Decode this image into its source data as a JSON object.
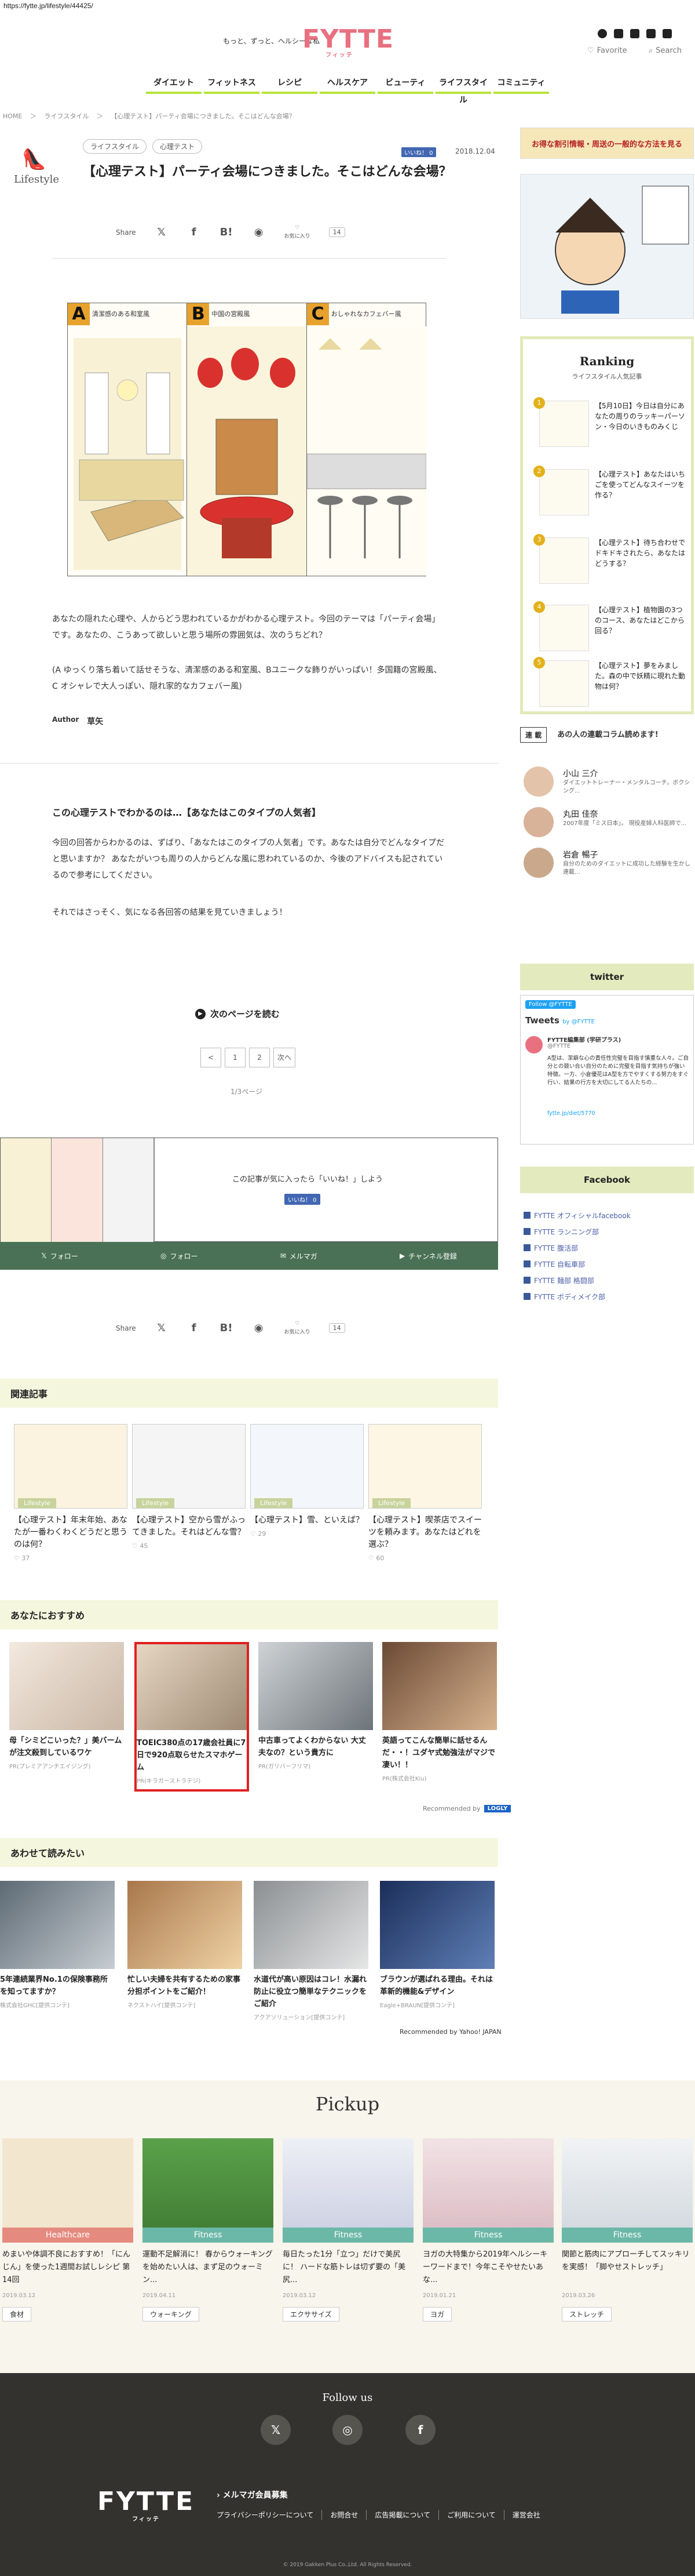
{
  "url": "https://fytte.jp/lifestyle/44425/",
  "header": {
    "tagline": "もっと、ずっと、ヘルシーな私",
    "logo": "FYTTE",
    "logo_sub": "フィッテ",
    "favorite": "Favorite",
    "search": "Search"
  },
  "nav": [
    "ダイエット",
    "フィットネス",
    "レシピ",
    "ヘルスケア",
    "ビューティ",
    "ライフスタイル",
    "コミュニティ"
  ],
  "breadcrumb": [
    "HOME",
    "＞",
    "ライフスタイル",
    "＞",
    "【心理テスト】パーティ会場につきました。そこはどんな会場？"
  ],
  "article": {
    "category": "Lifestyle",
    "tags": [
      "ライフスタイル",
      "心理テスト"
    ],
    "like_small": "いいね！ 0",
    "date": "2018.12.04",
    "title": "【心理テスト】パーティ会場につきました。そこはどんな会場？",
    "share_label": "Share",
    "fav_label": "お気に入り",
    "share_count": "14",
    "comic": {
      "a_letter": "A",
      "a_caption": "清潔感のある和室風",
      "b_letter": "B",
      "b_caption": "中国の宮殿風",
      "c_letter": "C",
      "c_caption": "おしゃれなカフェバー風"
    },
    "intro_1": "あなたの隠れた心理や、人からどう思われているかがわかる心理テスト。今回のテーマは「パーティ会場」です。あなたの、こうあって欲しいと思う場所の雰囲気は、次のうちどれ？",
    "intro_2": "(A ゆっくり落ち着いて話せそうな、清潔感のある和室風、Bユニークな飾りがいっぱい！多国籍の宮殿風、C オシャレで大人っぽい、隠れ家的なカフェバー風)",
    "author_label": "Author",
    "author_name": "草矢",
    "section_title": "この心理テストでわかるのは…【あなたはこのタイプの人気者】",
    "section_p1": "今回の回答からわかるのは、ずばり、「あなたはこのタイプの人気者」です。あなたは自分でどんなタイプだと思いますか？ あなたがいつも周りの人からどんな風に思われているのか、今後のアドバイスも記されているので参考にしてください。",
    "section_p2": "それではさっそく、気になる各回答の結果を見ていきましょう！",
    "next_page": "次のページを読む",
    "pager": [
      "<",
      "1",
      "2",
      "次へ"
    ],
    "page_indicator": "1/3ページ",
    "like_message": "この記事が気に入ったら「いいね！」しよう",
    "like_button": "いいね！ 0",
    "follow": [
      "フォロー",
      "フォロー",
      "メルマガ",
      "チャンネル登録"
    ]
  },
  "related": {
    "heading": "関連記事",
    "items": [
      {
        "label": "Lifestyle",
        "title": "【心理テスト】年末年始、あなたが一番わくわくどうだと思うのは何？",
        "count": "37"
      },
      {
        "label": "Lifestyle",
        "title": "【心理テスト】空から雪がふってきました。それはどんな雪？",
        "count": "45"
      },
      {
        "label": "Lifestyle",
        "title": "【心理テスト】雪、といえば？",
        "count": "29"
      },
      {
        "label": "Lifestyle",
        "title": "【心理テスト】喫茶店でスイーツを頼みます。あなたはどれを選ぶ？",
        "count": "60"
      }
    ]
  },
  "recommend": {
    "heading": "あなたにおすすめ",
    "items": [
      {
        "title": "母「シミどこいった？」美バームが注文殺到しているワケ",
        "source": "PR(プレミアアンチエイジング)"
      },
      {
        "title": "TOEIC380点の17歳会社員に7日で920点取らせたスマホゲーム",
        "source": "PR(キラガーストラテジ)"
      },
      {
        "title": "中古車ってよくわからない 大丈夫なの？という貴方に",
        "source": "PR(ガリバーフリマ)"
      },
      {
        "title": "英語ってこんな簡単に話せるんだ・・！ユダヤ式勉強法がマジで凄い！！",
        "source": "PR(株式会社Kiu)"
      }
    ],
    "recommended_by": "Recommended by",
    "logly": "LOGLY"
  },
  "together": {
    "heading": "あわせて読みたい",
    "items": [
      {
        "title": "5年連続業界No.1の保険事務所を知ってますか？",
        "source": "株式会社GHC[提供コンテ]"
      },
      {
        "title": "忙しい夫婦を共有するための家事分担ポイントをご紹介！",
        "source": "ネクストハイ[提供コンテ]"
      },
      {
        "title": "水道代が高い原因はコレ！水漏れ防止に役立つ簡単なテクニックをご紹介",
        "source": "アクアソリューション[提供コンテ]"
      },
      {
        "title": "ブラウンが選ばれる理由。それは革新的機能&デザイン",
        "source": "Eagle+BRAUN[提供コンテ]"
      }
    ],
    "recommended_by": "Recommended by Yahoo! JAPAN"
  },
  "pickup": {
    "heading": "Pickup",
    "items": [
      {
        "label": "Healthcare",
        "title": "めまいや体調不良におすすめ！「にんじん」を使った1週間お試しレシピ 第14回",
        "date": "2019.03.12",
        "tag": "食材",
        "color": "#e58a7f"
      },
      {
        "label": "Fitness",
        "title": "運動不足解消に！ 春からウォーキングを始めたい人は、まず足のウォーミン...",
        "date": "2019.04.11",
        "tag": "ウォーキング",
        "color": "#6cb8a8"
      },
      {
        "label": "Fitness",
        "title": "毎日たった1分「立つ」だけで美尻に！ ハードな筋トレは切ず要の「美尻...",
        "date": "2019.03.12",
        "tag": "エクササイズ",
        "color": "#6cb8a8"
      },
      {
        "label": "Fitness",
        "title": "ヨガの大特集から2019年ヘルシーキーワードまで！今年こそやせたいあな...",
        "date": "2019.01.21",
        "tag": "ヨガ",
        "color": "#6cb8a8"
      },
      {
        "label": "Fitness",
        "title": "関節と筋肉にアプローチしてスッキリを実感！「脚やせストレッチ」",
        "date": "2019.03.26",
        "tag": "ストレッチ",
        "color": "#6cb8a8"
      }
    ]
  },
  "sidebar": {
    "banner1": "お得な割引情報・周送の一般的な方法を見る",
    "ranking_title": "Ranking",
    "ranking_sub": "ライフスタイル人気記事",
    "ranking": [
      {
        "num": "1",
        "title": "【5月10日】今日は自分にあなたの周りのラッキーパーソン・今日のいきものみくじ"
      },
      {
        "num": "2",
        "title": "【心理テスト】あなたはいちごを使ってどんなスイーツを作る？"
      },
      {
        "num": "3",
        "title": "【心理テスト】待ち合わせでドキドキされたら、あなたはどうする？"
      },
      {
        "num": "4",
        "title": "【心理テスト】植物園の3つのコース、あなたはどこから回る？"
      },
      {
        "num": "5",
        "title": "【心理テスト】夢をみました。森の中で妖精に現れた動物は何？"
      }
    ],
    "readers_box": "連 載",
    "readers_title": "あの人の連載コラム読めます!",
    "people": [
      {
        "name": "小山 三介",
        "desc": "ダイエットトレーナー・メンタルコーチ。ボクシング..."
      },
      {
        "name": "丸田 佳奈",
        "desc": "2007年度「ミス日本」。 現役産婦人科医師で..."
      },
      {
        "name": "岩倉 暢子",
        "desc": "自分のためのダイエットに成功した経験を生かし連載..."
      }
    ],
    "twitter_h": "twitter",
    "tw_follow": "Follow @FYTTE",
    "tw_tweets": "Tweets",
    "tw_by": "by @FYTTE",
    "tw_name": "FYTTE編集部 (学研プラス)",
    "tw_handle": "@FYTTE",
    "tw_text": "A型は、潔癖な心の責任性完璧を目指す慎重な人々。ご自分との競い合い自分のために完璧を目指す気持ちが強い特徴。一方、小倉優花はA型を方でやすくする努力をすぐ行い、結果の行方を大切にしてる人たちの...",
    "tw_link": "fytte.jp/diet/5770",
    "facebook_h": "Facebook",
    "fb_links": [
      "FYTTE オフィシャルfacebook",
      "FYTTE ランニング部",
      "FYTTE 腹活部",
      "FYTTE 自転車部",
      "FYTTE 麺部 格闘部",
      "FYTTE ボディメイク部"
    ]
  },
  "footer": {
    "follow_us": "Follow us",
    "logo": "FYTTE",
    "logo_sub": "フィッテ",
    "member": "メルマガ会員募集",
    "links": [
      "プライバシーポリシーについて",
      "お問合せ",
      "広告掲載について",
      "ご利用について",
      "運営会社"
    ],
    "copyright": "© 2019 Gakken Plus Co.,Ltd. All Rights Reserved."
  }
}
